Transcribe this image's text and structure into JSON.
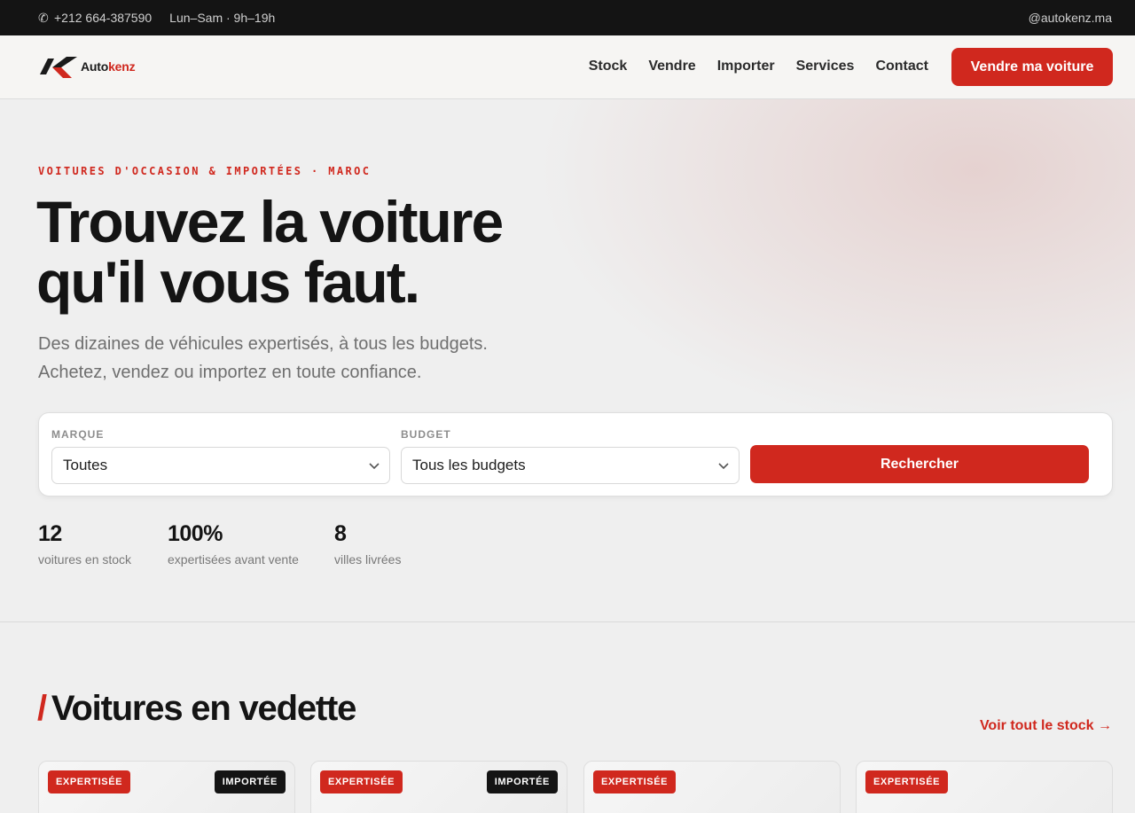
{
  "topbar": {
    "phone": "+212 664-387590",
    "hours": "Lun–Sam · 9h–19h",
    "handle": "@autokenz.ma"
  },
  "header": {
    "logo_part1": "Auto",
    "logo_part2": "kenz",
    "nav": [
      "Stock",
      "Vendre",
      "Importer",
      "Services",
      "Contact"
    ],
    "cta_label": "Vendre ma voiture"
  },
  "hero": {
    "eyebrow": "VOITURES D'OCCASION & IMPORTÉES · MAROC",
    "title_line1": "Trouvez la voiture",
    "title_line2": "qu'il vous faut.",
    "subtitle_line1": "Des dizaines de véhicules expertisés, à tous les budgets.",
    "subtitle_line2": "Achetez, vendez ou importez en toute confiance."
  },
  "search": {
    "brand_label": "MARQUE",
    "brand_value": "Toutes",
    "budget_label": "BUDGET",
    "budget_value": "Tous les budgets",
    "button_label": "Rechercher"
  },
  "stats": [
    {
      "value": "12",
      "label": "voitures en stock"
    },
    {
      "value": "100%",
      "label": "expertisées avant vente"
    },
    {
      "value": "8",
      "label": "villes livrées"
    }
  ],
  "featured": {
    "slash": "/",
    "title": "Voitures en vedette",
    "see_all": "Voir tout le stock →",
    "cards": [
      {
        "badge": "EXPERTISÉE",
        "tag": "IMPORTÉE"
      },
      {
        "badge": "EXPERTISÉE",
        "tag": "IMPORTÉE"
      },
      {
        "badge": "EXPERTISÉE"
      },
      {
        "badge": "EXPERTISÉE"
      }
    ]
  },
  "colors": {
    "accent": "#d0281e",
    "dark": "#141414"
  }
}
